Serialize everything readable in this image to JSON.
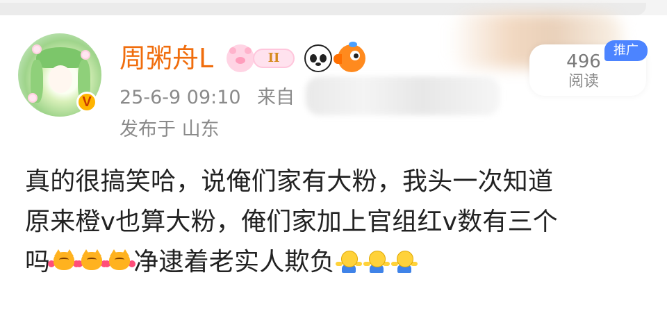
{
  "post": {
    "author": {
      "name": "周粥舟L",
      "verified_mark": "V"
    },
    "badges": {
      "ribbon_text": "II"
    },
    "meta": {
      "time": "25-6-9 09:10",
      "source_label": "来自",
      "location": "发布于 山东"
    },
    "stats": {
      "read_count": "496",
      "read_label": "阅读",
      "promo_tag": "推广"
    },
    "content": {
      "line1": "真的很搞笑哈，说俺们家有大粉，我头一次知道",
      "line2": "原来橙v也算大粉，俺们家加上官组红v数有三个",
      "line3_prefix": "吗",
      "line3_middle": "净逮着老实人欺负"
    }
  },
  "icons": {
    "avatar": "anime-girl-avatar",
    "verified": "orange-verified-icon",
    "pig": "pink-pig-icon",
    "ribbon": "gemini-ribbon-icon",
    "panda": "panda-icon",
    "fish": "orange-fish-icon",
    "cat_emoji": "cat-with-hearts-icon",
    "shrug_emoji": "shrug-icon"
  },
  "colors": {
    "username": "#f06d0d",
    "meta_text": "#8a8a8a",
    "promo": "#4c84ff",
    "body_text": "#222222"
  }
}
